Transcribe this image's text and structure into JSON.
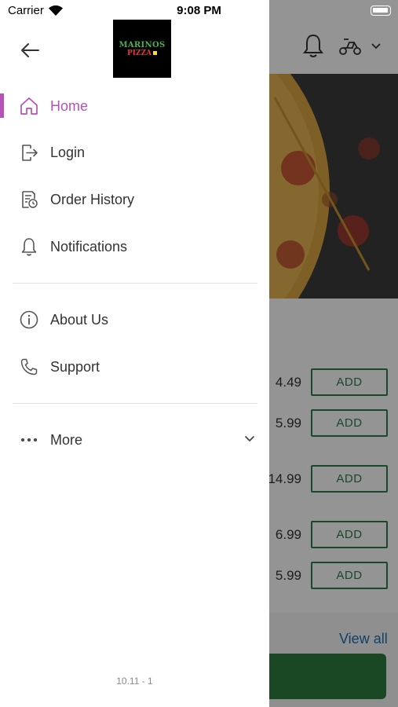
{
  "status_bar": {
    "carrier": "Carrier",
    "time": "9:08 PM"
  },
  "logo": {
    "line1": "MARINOS",
    "line2": "PIZZA"
  },
  "drawer": {
    "items": [
      {
        "label": "Home",
        "icon": "home-icon",
        "active": true
      },
      {
        "label": "Login",
        "icon": "login-icon"
      },
      {
        "label": "Order History",
        "icon": "order-history-icon"
      },
      {
        "label": "Notifications",
        "icon": "bell-icon"
      },
      {
        "label": "About Us",
        "icon": "info-icon"
      },
      {
        "label": "Support",
        "icon": "phone-icon"
      },
      {
        "label": "More",
        "icon": "more-dots-icon"
      }
    ],
    "version": "10.11 - 1"
  },
  "background_menu": {
    "items": [
      {
        "price": "4.49",
        "button": "ADD"
      },
      {
        "price": "5.99",
        "button": "ADD"
      },
      {
        "price": "14.99",
        "button": "ADD"
      },
      {
        "price": "6.99",
        "button": "ADD"
      },
      {
        "price": "5.99",
        "button": "ADD"
      }
    ],
    "view_all": "View all"
  },
  "colors": {
    "accent": "#b552b8",
    "add_button": "#2e7d4a",
    "view_all": "#1a6fb0",
    "cart_button": "#2f7d3e"
  }
}
